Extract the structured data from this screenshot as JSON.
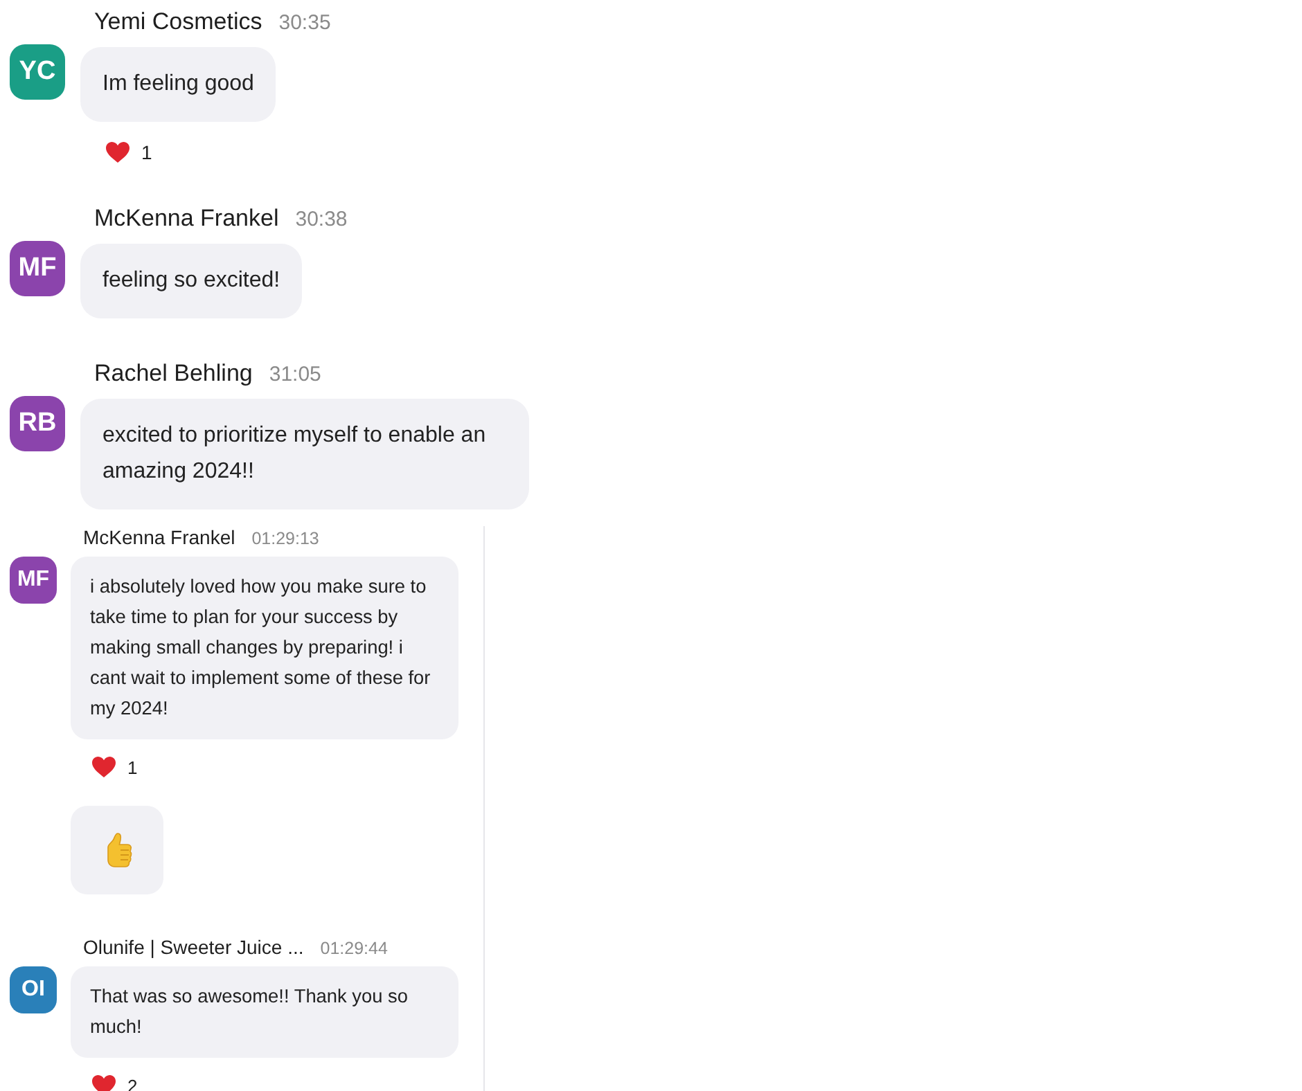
{
  "sections": [
    {
      "kind": "large",
      "messages": [
        {
          "initials": "YC",
          "color": "#1a9e86",
          "author": "Yemi Cosmetics",
          "time": "30:35",
          "bubbles": [
            {
              "kind": "text",
              "text": "Im feeling good"
            }
          ],
          "reactions": [
            {
              "count": "1"
            }
          ]
        },
        {
          "initials": "MF",
          "color": "#8b44ac",
          "author": "McKenna Frankel",
          "time": "30:38",
          "bubbles": [
            {
              "kind": "text",
              "text": "feeling so excited!"
            }
          ]
        },
        {
          "initials": "RB",
          "color": "#8b44ac",
          "author": "Rachel Behling",
          "time": "31:05",
          "bubbles": [
            {
              "kind": "text",
              "text": "excited to prioritize myself to enable an amazing 2024!!"
            }
          ]
        }
      ]
    },
    {
      "kind": "compact",
      "messages": [
        {
          "initials": "MF",
          "color": "#8b44ac",
          "author": "McKenna Frankel",
          "time": "01:29:13",
          "bubbles": [
            {
              "kind": "text",
              "text": "i absolutely loved how you make sure to take time to plan for your success by making small changes by preparing! i cant wait to implement some of these for my 2024!"
            }
          ],
          "reactions": [
            {
              "count": "1"
            }
          ]
        },
        {
          "bubbles": [
            {
              "kind": "emoji"
            }
          ]
        },
        {
          "initials": "OI",
          "color": "#2a80b9",
          "author": "Olunife | Sweeter Juice ...",
          "time": "01:29:44",
          "bubbles": [
            {
              "kind": "text",
              "text": "That was so awesome!! Thank you so much!"
            }
          ],
          "reactions": [
            {
              "count": "2"
            }
          ]
        }
      ]
    }
  ]
}
